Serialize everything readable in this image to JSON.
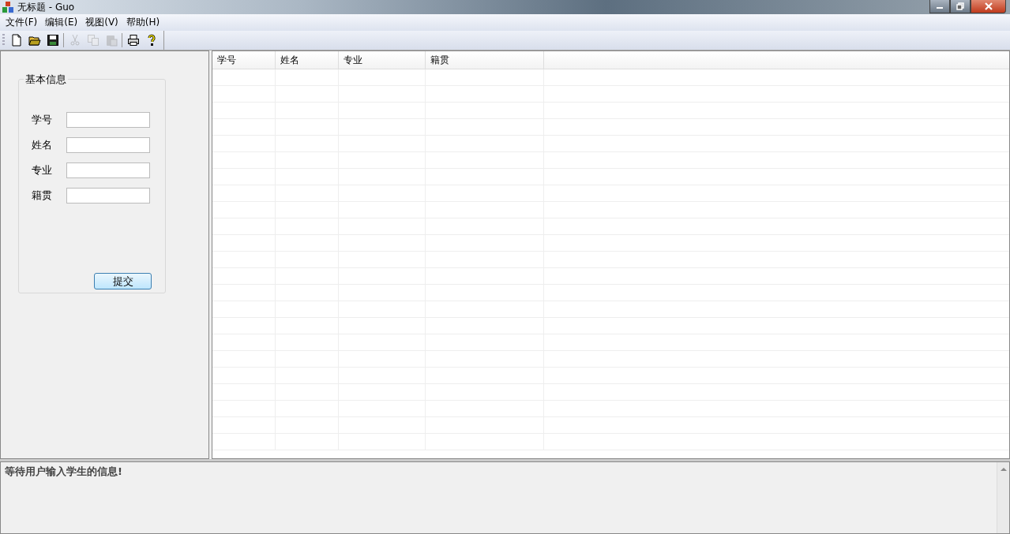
{
  "window": {
    "title": "无标题 - Guo"
  },
  "menu": [
    "文件(F)",
    "编辑(E)",
    "视图(V)",
    "帮助(H)"
  ],
  "toolbar": [
    {
      "kind": "new",
      "disabled": false
    },
    {
      "kind": "open",
      "disabled": false
    },
    {
      "kind": "save",
      "disabled": false
    },
    {
      "kind": "separator"
    },
    {
      "kind": "cut",
      "disabled": true
    },
    {
      "kind": "copy",
      "disabled": true
    },
    {
      "kind": "paste",
      "disabled": true
    },
    {
      "kind": "separator"
    },
    {
      "kind": "print",
      "disabled": false
    },
    {
      "kind": "help",
      "disabled": false
    }
  ],
  "form": {
    "title": "基本信息",
    "fields": [
      {
        "label": "学号"
      },
      {
        "label": "姓名"
      },
      {
        "label": "专业"
      },
      {
        "label": "籍贯"
      }
    ],
    "submit": "提交"
  },
  "table": {
    "columns": [
      "学号",
      "姓名",
      "专业",
      "籍贯"
    ]
  },
  "log": {
    "message": "等待用户输入学生的信息!"
  }
}
